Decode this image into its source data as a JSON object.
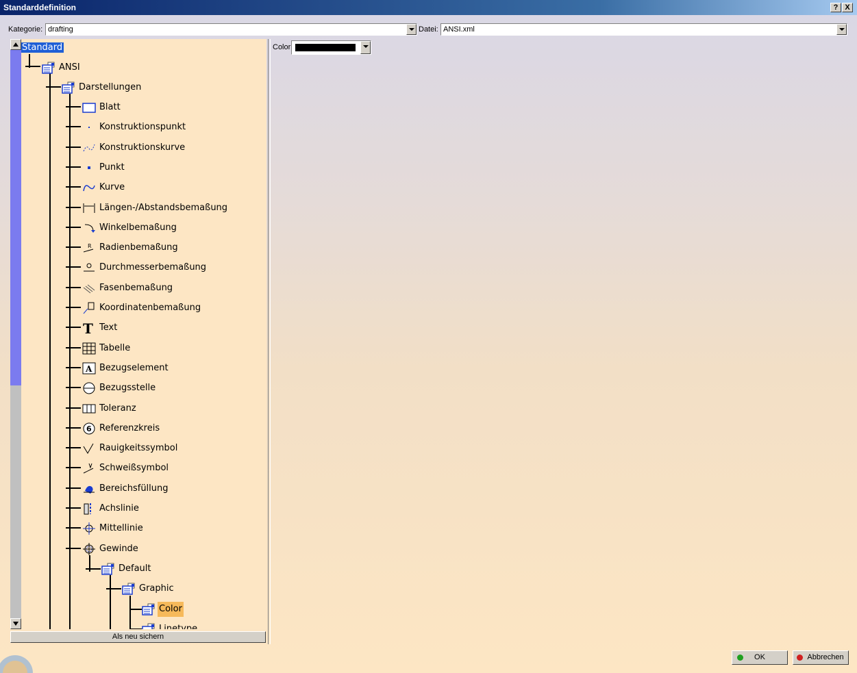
{
  "window": {
    "title": "Standarddefinition",
    "help_label": "?",
    "close_label": "X"
  },
  "toolbar": {
    "kategorie_label": "Kategorie:",
    "kategorie_value": "drafting",
    "datei_label": "Datei:",
    "datei_value": "ANSI.xml"
  },
  "tree": {
    "root": "Standard",
    "ansi": "ANSI",
    "darstellungen": "Darstellungen",
    "items": [
      "Blatt",
      "Konstruktionspunkt",
      "Konstruktionskurve",
      "Punkt",
      "Kurve",
      "Längen-/Abstandsbemaßung",
      "Winkelbemaßung",
      "Radienbemaßung",
      "Durchmesserbemaßung",
      "Fasenbemaßung",
      "Koordinatenbemaßung",
      "Text",
      "Tabelle",
      "Bezugselement",
      "Bezugsstelle",
      "Toleranz",
      "Referenzkreis",
      "Rauigkeitssymbol",
      "Schweißsymbol",
      "Bereichsfüllung",
      "Achslinie",
      "Mittellinie",
      "Gewinde"
    ],
    "default": "Default",
    "graphic": "Graphic",
    "color": "Color",
    "linetype": "Linetype",
    "text_glyph": "T",
    "bezug_glyph": "A",
    "ref_glyph": "6"
  },
  "save_button": "Als neu sichern",
  "properties": {
    "color_label": "Color",
    "color_value": "#000000"
  },
  "buttons": {
    "ok": "OK",
    "cancel": "Abbrechen"
  },
  "colors": {
    "ok_led": "#20a020",
    "cancel_led": "#d02020",
    "selection": "#1f5fd6",
    "highlight": "#f6b95a"
  }
}
